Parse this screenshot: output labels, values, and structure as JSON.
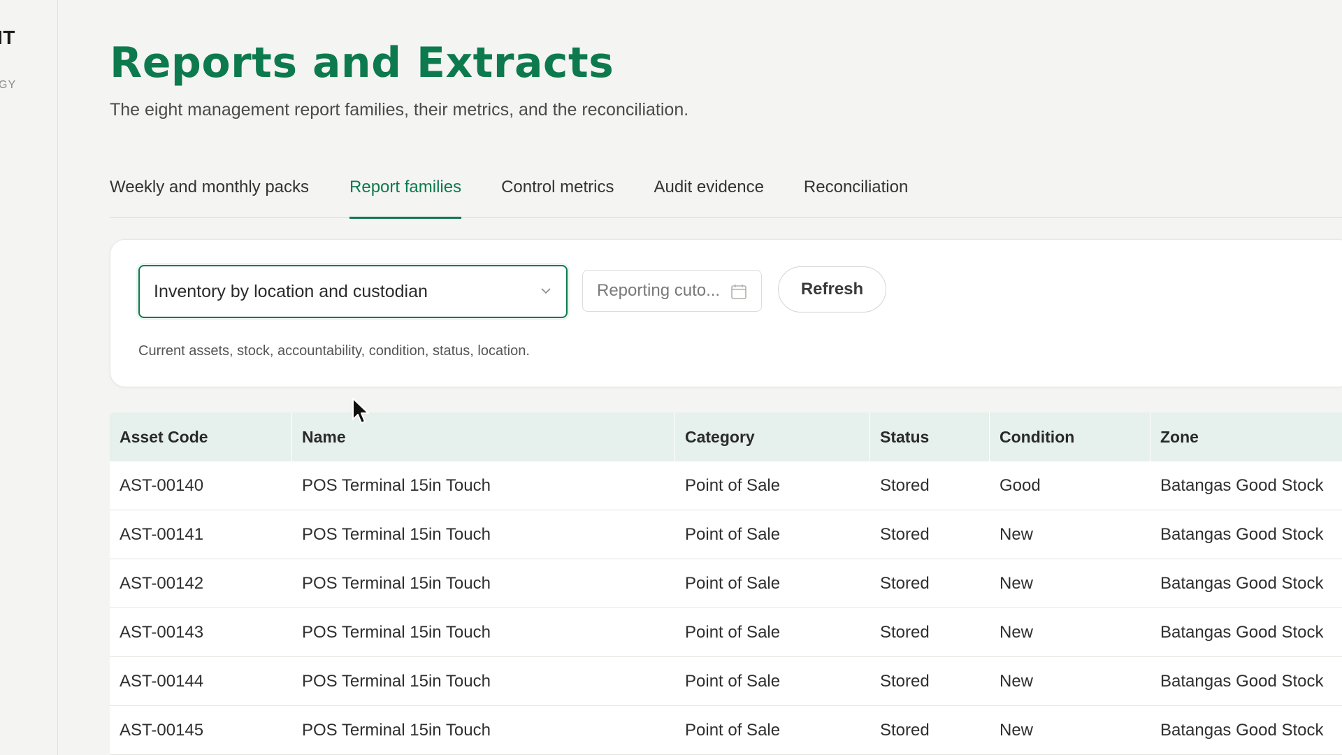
{
  "sidebar": {
    "brand_title": "IT",
    "brand_sub": "GY"
  },
  "page": {
    "title": "Reports and Extracts",
    "subtitle": "The eight management report families, their metrics, and the reconciliation."
  },
  "tabs": [
    {
      "label": "Weekly and monthly packs"
    },
    {
      "label": "Report families",
      "active": true
    },
    {
      "label": "Control metrics"
    },
    {
      "label": "Audit evidence"
    },
    {
      "label": "Reconciliation"
    }
  ],
  "filters": {
    "family_select": "Inventory by location and custodian",
    "date_placeholder": "Reporting cuto...",
    "refresh_label": "Refresh",
    "family_description": "Current assets, stock, accountability, condition, status, location."
  },
  "table": {
    "headers": [
      "Asset Code",
      "Name",
      "Category",
      "Status",
      "Condition",
      "Zone"
    ],
    "rows": [
      [
        "AST-00140",
        "POS Terminal 15in Touch",
        "Point of Sale",
        "Stored",
        "Good",
        "Batangas Good Stock"
      ],
      [
        "AST-00141",
        "POS Terminal 15in Touch",
        "Point of Sale",
        "Stored",
        "New",
        "Batangas Good Stock"
      ],
      [
        "AST-00142",
        "POS Terminal 15in Touch",
        "Point of Sale",
        "Stored",
        "New",
        "Batangas Good Stock"
      ],
      [
        "AST-00143",
        "POS Terminal 15in Touch",
        "Point of Sale",
        "Stored",
        "New",
        "Batangas Good Stock"
      ],
      [
        "AST-00144",
        "POS Terminal 15in Touch",
        "Point of Sale",
        "Stored",
        "New",
        "Batangas Good Stock"
      ],
      [
        "AST-00145",
        "POS Terminal 15in Touch",
        "Point of Sale",
        "Stored",
        "New",
        "Batangas Good Stock"
      ]
    ]
  },
  "colors": {
    "accent": "#0d7a4e",
    "header_bg": "#e6f0ec",
    "page_bg": "#f4f4f2"
  },
  "icons": {
    "select_chevron": "chevron-down-icon",
    "date": "calendar-icon",
    "pointer": "mouse-cursor-icon"
  }
}
